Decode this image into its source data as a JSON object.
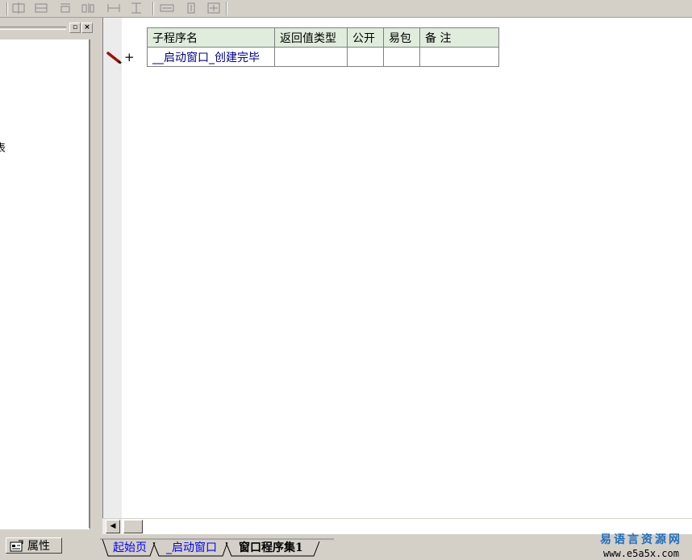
{
  "toolbar": {
    "icons": [
      "align-left-icon",
      "align-center-icon",
      "align-right-icon",
      "distribute-icon",
      "h-center-icon",
      "v-center-icon",
      "same-width-icon",
      "same-height-icon",
      "same-size-icon"
    ]
  },
  "left_panel": {
    "partial_text": "表"
  },
  "subroutine_table": {
    "headers": [
      "子程序名",
      "返回值类型",
      "公开",
      "易包",
      "备 注"
    ],
    "rows": [
      {
        "name": "__启动窗口_创建完毕",
        "return_type": "",
        "public": "",
        "easy_pkg": "",
        "note": ""
      }
    ]
  },
  "gutter": {
    "expand_symbol": "+"
  },
  "bottom": {
    "property_tab": "属性",
    "doc_tabs": [
      {
        "label": "起始页"
      },
      {
        "label": "_启动窗口"
      },
      {
        "label": "窗口程序集1"
      }
    ]
  },
  "watermark": {
    "name": "易语言资源网",
    "url": "www.e5a5x.com"
  },
  "colors": {
    "header_bg": "#e0ecdc",
    "link": "#0000ff",
    "watermark": "#1e6fc0"
  }
}
